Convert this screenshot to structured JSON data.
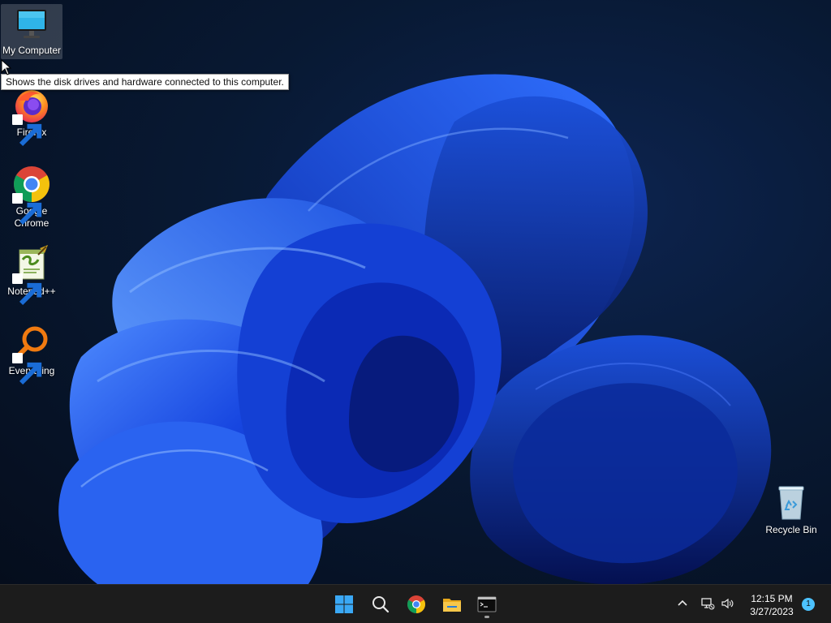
{
  "desktop": {
    "icons": [
      {
        "label": "My Computer",
        "icon": "monitor-icon",
        "selected": true
      },
      {
        "label": "Firefox",
        "icon": "firefox-icon",
        "shortcut": true
      },
      {
        "label": "Google Chrome",
        "icon": "chrome-icon",
        "shortcut": true
      },
      {
        "label": "Notepad++",
        "icon": "notepadpp-icon",
        "shortcut": true
      },
      {
        "label": "Everything",
        "icon": "everything-search-icon",
        "shortcut": true
      },
      {
        "label": "Recycle Bin",
        "icon": "recycle-bin-icon"
      }
    ],
    "tooltip": "Shows the disk drives and hardware connected to this computer."
  },
  "taskbar": {
    "buttons": [
      {
        "name": "start-button",
        "icon": "windows-logo-icon"
      },
      {
        "name": "search-button",
        "icon": "search-icon"
      },
      {
        "name": "chrome-taskbar-button",
        "icon": "chrome-icon"
      },
      {
        "name": "file-explorer-button",
        "icon": "folder-icon"
      },
      {
        "name": "terminal-button",
        "icon": "terminal-icon",
        "running": true
      }
    ],
    "tray": {
      "icons": [
        "chevron-up-icon",
        "network-icon",
        "volume-icon"
      ],
      "time": "12:15 PM",
      "date": "3/27/2023",
      "notification_count": "1"
    }
  },
  "colors": {
    "taskbar_bg": "#1c1c1c",
    "wallpaper_dark": "#050d1c",
    "bloom_blue": "#1a4fe0",
    "notif_badge": "#4cc2ff"
  }
}
